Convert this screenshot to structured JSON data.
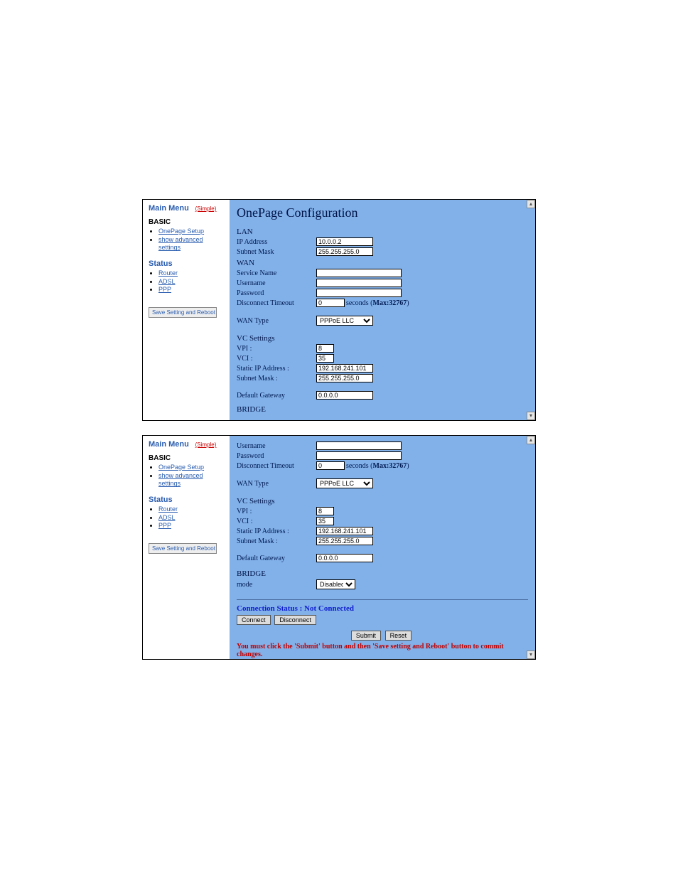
{
  "sidebar": {
    "main_menu": "Main Menu",
    "simple": "(Simple)",
    "basic_hdr": "BASIC",
    "basic_items": [
      "OnePage Setup",
      "show advanced settings"
    ],
    "status_hdr": "Status",
    "status_items": [
      "Router",
      "ADSL",
      "PPP"
    ],
    "save_button": "Save Setting and Reboot"
  },
  "top": {
    "title": "OnePage Configuration",
    "lan_hdr": "LAN",
    "ip_label": "IP Address",
    "ip_val": "10.0.0.2",
    "mask_label": "Subnet Mask",
    "mask_val": "255.255.255.0",
    "wan_hdr": "WAN",
    "svc_label": "Service Name",
    "svc_val": "",
    "user_label": "Username",
    "user_val": "",
    "pass_label": "Password",
    "pass_val": "",
    "disc_label": "Disconnect Timeout",
    "disc_val": "0",
    "disc_note_a": " seconds (",
    "disc_note_bold": "Max:32767",
    "disc_note_b": ")",
    "wantype_label": "WAN Type",
    "wantype_val": "PPPoE LLC",
    "vc_hdr": "VC Settings",
    "vpi_label": "VPI :",
    "vpi_val": "8",
    "vci_label": "VCI :",
    "vci_val": "35",
    "sip_label": "Static IP Address :",
    "sip_val": "192.168.241.101",
    "smask_label": "Subnet Mask :",
    "smask_val": "255.255.255.0",
    "gw_label": "Default Gateway",
    "gw_val": "0.0.0.0",
    "bridge_hdr": "BRIDGE"
  },
  "bot": {
    "user_label": "Username",
    "user_val": "",
    "pass_label": "Password",
    "pass_val": "",
    "disc_label": "Disconnect Timeout",
    "disc_val": "0",
    "disc_note_a": " seconds (",
    "disc_note_bold": "Max:32767",
    "disc_note_b": ")",
    "wantype_label": "WAN Type",
    "wantype_val": "PPPoE LLC",
    "vc_hdr": "VC Settings",
    "vpi_label": "VPI :",
    "vpi_val": "8",
    "vci_label": "VCI :",
    "vci_val": "35",
    "sip_label": "Static IP Address :",
    "sip_val": "192.168.241.101",
    "smask_label": "Subnet Mask :",
    "smask_val": "255.255.255.0",
    "gw_label": "Default Gateway",
    "gw_val": "0.0.0.0",
    "bridge_hdr": "BRIDGE",
    "mode_label": "mode",
    "mode_val": "Disabled",
    "conn_status": "Connection Status : Not Connected",
    "connect_btn": "Connect",
    "disconnect_btn": "Disconnect",
    "submit_btn": "Submit",
    "reset_btn": "Reset",
    "warn": "You must click the 'Submit' button and then 'Save setting and Reboot' button to commit changes."
  }
}
